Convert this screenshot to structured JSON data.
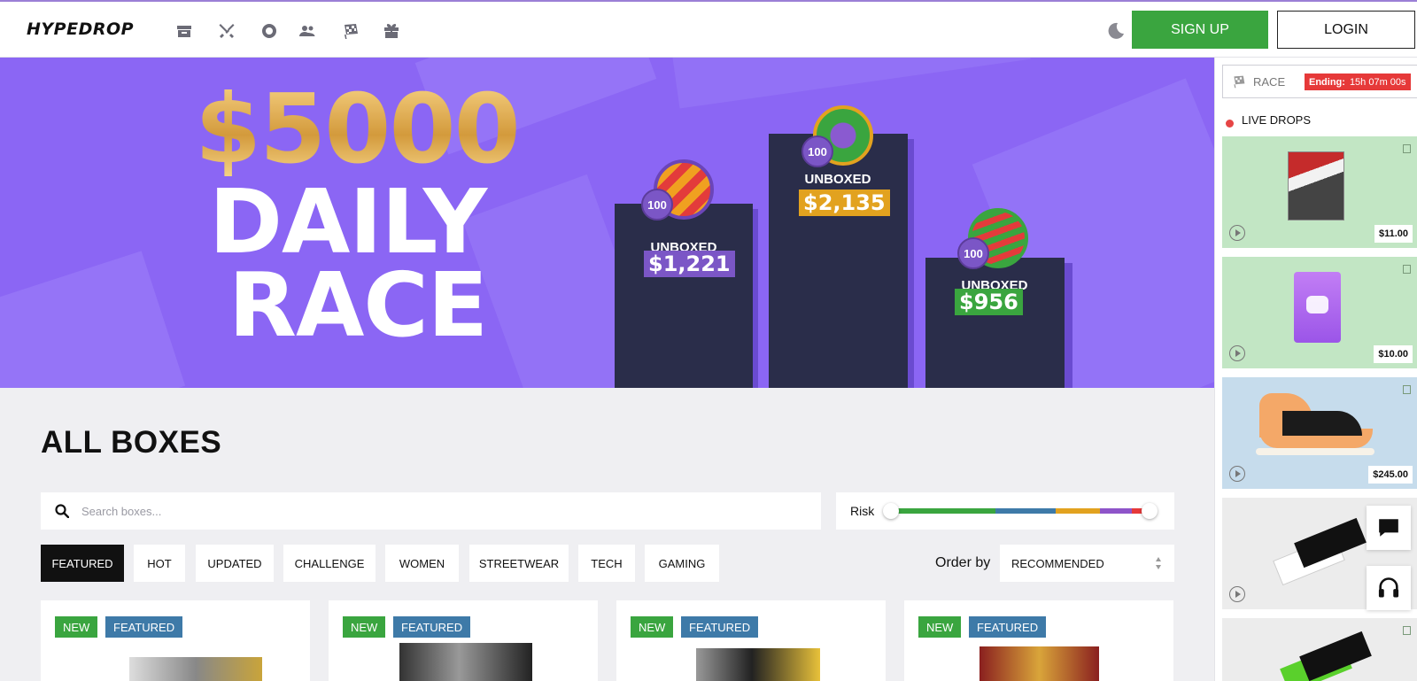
{
  "header": {
    "logo": "HYPEDROP",
    "nav": [
      "boxes-icon",
      "battles-icon",
      "deals-icon",
      "affiliates-icon",
      "race-flag-icon",
      "rewards-gift-icon"
    ],
    "signup_label": "SIGN UP",
    "login_label": "LOGIN"
  },
  "banner": {
    "amount": "$5000",
    "line1": "DAILY",
    "line2": "RACE",
    "podiums": [
      {
        "rank_badge": "100",
        "label": "UNBOXED",
        "value": "$1,221",
        "value_color": "#7b56c6"
      },
      {
        "rank_badge": "100",
        "label": "UNBOXED",
        "value": "$2,135",
        "value_color": "#e2a21f"
      },
      {
        "rank_badge": "100",
        "label": "UNBOXED",
        "value": "$956",
        "value_color": "#3aa53f"
      }
    ]
  },
  "sidebar": {
    "race_label": "RACE",
    "ending_label": "Ending:",
    "ending_time": "15h 07m 00s",
    "live_label": "LIVE DROPS",
    "drops": [
      {
        "price": "$11.00",
        "bg": "#c2e6c4",
        "item": "video-game-cover"
      },
      {
        "price": "$10.00",
        "bg": "#c2e6c4",
        "item": "discord-nitro-card"
      },
      {
        "price": "$245.00",
        "bg": "#c6dcec",
        "item": "sneaker"
      },
      {
        "price": "",
        "bg": "#ececec",
        "item": "hd-tickets"
      },
      {
        "price": "",
        "bg": "#ececec",
        "item": "hd-tickets-green"
      }
    ]
  },
  "main": {
    "title": "ALL BOXES",
    "search_placeholder": "Search boxes...",
    "risk_label": "Risk",
    "tabs": [
      "FEATURED",
      "HOT",
      "UPDATED",
      "CHALLENGE",
      "WOMEN",
      "STREETWEAR",
      "TECH",
      "GAMING"
    ],
    "active_tab": "FEATURED",
    "order_label": "Order by",
    "order_value": "RECOMMENDED",
    "cards": [
      {
        "tag_new": "NEW",
        "tag_featured": "FEATURED"
      },
      {
        "tag_new": "NEW",
        "tag_featured": "FEATURED"
      },
      {
        "tag_new": "NEW",
        "tag_featured": "FEATURED"
      },
      {
        "tag_new": "NEW",
        "tag_featured": "FEATURED"
      }
    ]
  },
  "colors": {
    "accent_green": "#3aa53f",
    "banner_purple": "#8b66f4",
    "podium_navy": "#2a2d4a",
    "ending_red": "#e63939",
    "featured_blue": "#3e7aa8",
    "risk_segments": [
      "#3aa53f",
      "#3e7aa8",
      "#e2a21f",
      "#8e54c9",
      "#e63939"
    ]
  }
}
